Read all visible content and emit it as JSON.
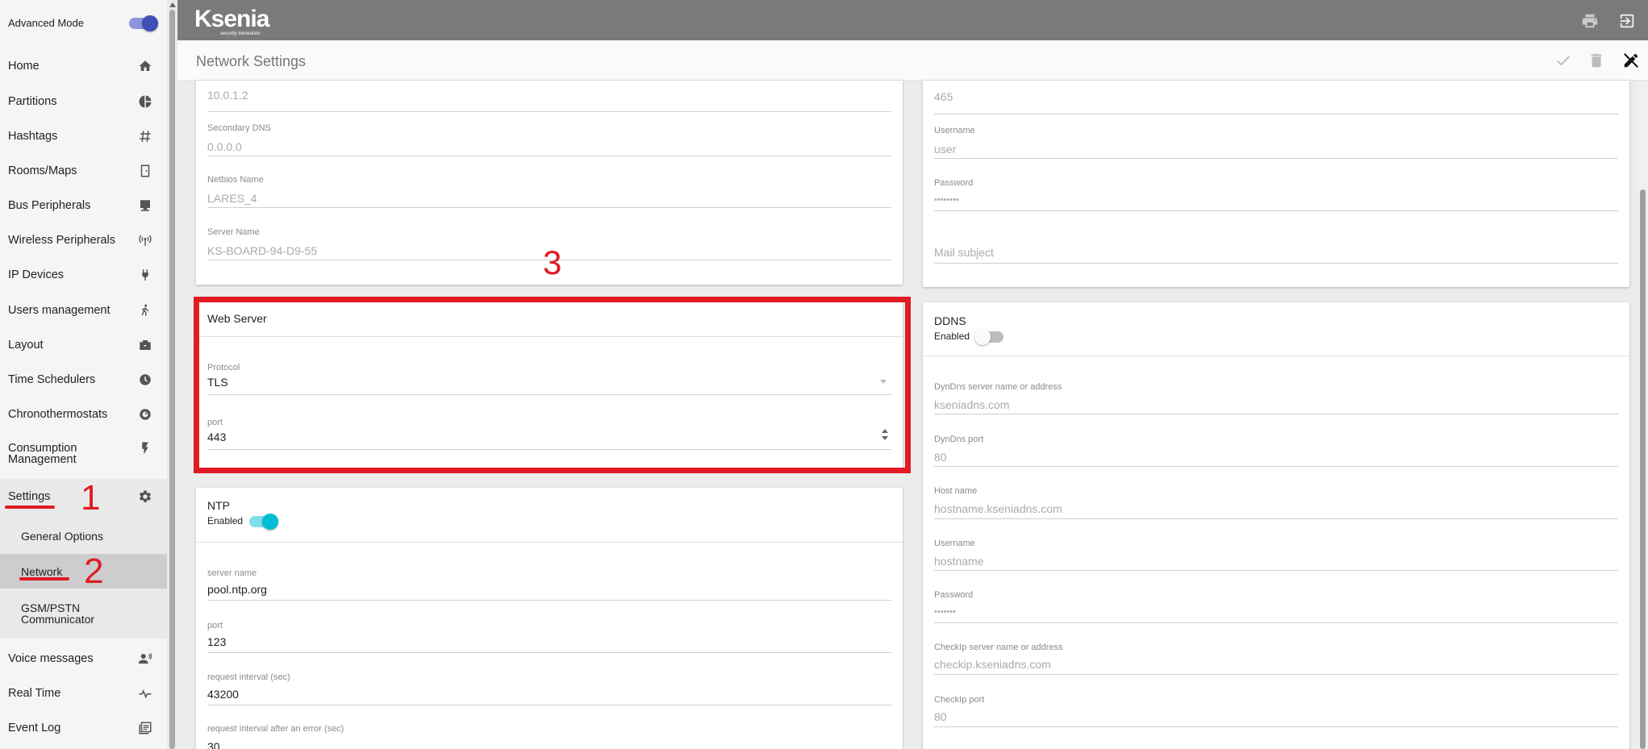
{
  "sidebar": {
    "advanced_mode_label": "Advanced Mode",
    "items": [
      {
        "label": "Home",
        "icon": "home-icon"
      },
      {
        "label": "Partitions",
        "icon": "pie-chart-icon"
      },
      {
        "label": "Hashtags",
        "icon": "hashtag-icon"
      },
      {
        "label": "Rooms/Maps",
        "icon": "door-icon"
      },
      {
        "label": "Bus Peripherals",
        "icon": "monitor-icon"
      },
      {
        "label": "Wireless Peripherals",
        "icon": "antenna-icon"
      },
      {
        "label": "IP Devices",
        "icon": "plug-icon"
      },
      {
        "label": "Users management",
        "icon": "person-walking-icon"
      },
      {
        "label": "Layout",
        "icon": "briefcase-icon"
      },
      {
        "label": "Time Schedulers",
        "icon": "clock-icon"
      },
      {
        "label": "Chronothermostats",
        "icon": "thermostat-icon"
      },
      {
        "label": "Consumption Management",
        "icon": "flash-icon"
      },
      {
        "label": "Settings",
        "icon": "gear-icon"
      },
      {
        "label": "Voice messages",
        "icon": "voice-icon"
      },
      {
        "label": "Real Time",
        "icon": "pulse-icon"
      },
      {
        "label": "Event Log",
        "icon": "log-icon"
      }
    ],
    "sub_items": [
      {
        "label": "General Options"
      },
      {
        "label": "Network"
      },
      {
        "label": "GSM/PSTN Communicator"
      }
    ]
  },
  "annotations": {
    "one": "1",
    "two": "2",
    "three": "3"
  },
  "header": {
    "logo": "Ksenia",
    "logo_tagline": "security innovation",
    "page_title": "Network Settings"
  },
  "left_top_card": {
    "partial_value": "10.0.1.2",
    "secondary_dns_label": "Secondary DNS",
    "secondary_dns": "0.0.0.0",
    "netbios_label": "Netbios Name",
    "netbios": "LARES_4",
    "server_name_label": "Server Name",
    "server_name": "KS-BOARD-94-D9-55"
  },
  "web_server": {
    "title": "Web Server",
    "protocol_label": "Protocol",
    "protocol": "TLS",
    "port_label": "port",
    "port": "443"
  },
  "ntp": {
    "title": "NTP",
    "enabled_label": "Enabled",
    "enabled": true,
    "server_label": "server name",
    "server": "pool.ntp.org",
    "port_label": "port",
    "port": "123",
    "interval_label": "request interval (sec)",
    "interval": "43200",
    "error_interval_label": "request interval after an error (sec)",
    "error_interval": "30"
  },
  "right_top_card": {
    "partial_value": "465",
    "username_label": "Username",
    "username": "user",
    "password_label": "Password",
    "password": "••••••••",
    "mail_subject_placeholder": "Mail subject"
  },
  "ddns": {
    "title": "DDNS",
    "enabled_label": "Enabled",
    "enabled": false,
    "server_label": "DynDns server name or address",
    "server": "kseniadns.com",
    "port_label": "DynDns port",
    "port": "80",
    "host_label": "Host name",
    "host": "hostname.kseniadns.com",
    "username_label": "Username",
    "username": "hostname",
    "password_label": "Password",
    "password": "•••••••",
    "checkip_label": "CheckIp server name or address",
    "checkip": "checkip.kseniadns.com",
    "checkip_port_label": "CheckIp port",
    "checkip_port": "80"
  },
  "colors": {
    "accent": "#3f51b5",
    "toggle_on": "#00bcd4",
    "annotation": "#e01b24",
    "topbar": "#7a7a7a"
  }
}
